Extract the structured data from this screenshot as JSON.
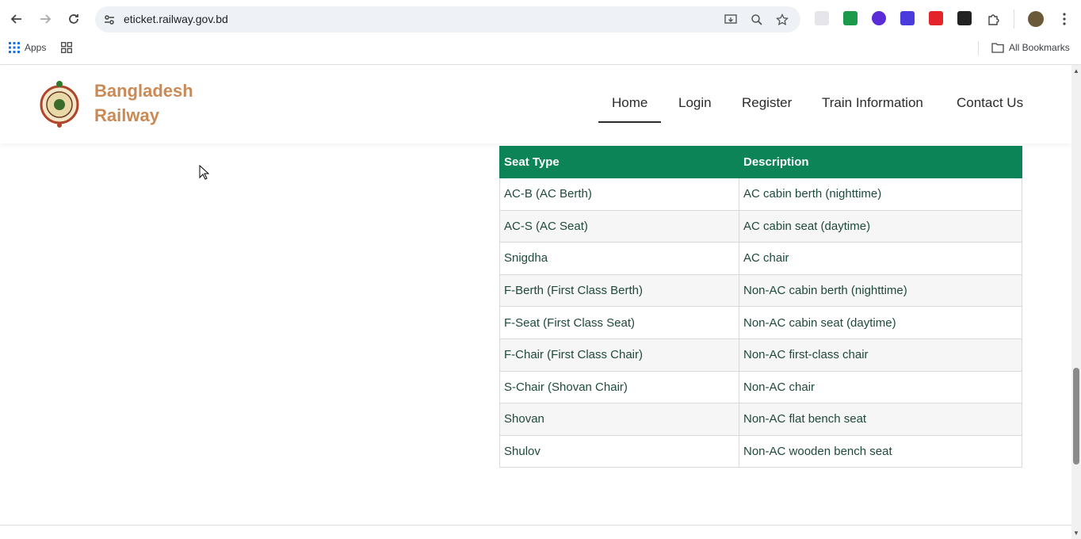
{
  "browser": {
    "url": "eticket.railway.gov.bd",
    "bookmarks": {
      "apps_label": "Apps",
      "all_bookmarks_label": "All Bookmarks"
    }
  },
  "site": {
    "brand_line1": "Bangladesh",
    "brand_line2": "Railway",
    "nav": {
      "home": "Home",
      "login": "Login",
      "register": "Register",
      "train_information": "Train Information",
      "contact_us": "Contact Us"
    },
    "active_nav": "Home",
    "brand_color": "#c98a55",
    "accent_color": "#0d8457"
  },
  "table": {
    "headers": [
      "Seat Type",
      "Description"
    ],
    "rows": [
      [
        "AC-B (AC Berth)",
        "AC cabin berth (nighttime)"
      ],
      [
        "AC-S (AC Seat)",
        "AC cabin seat (daytime)"
      ],
      [
        "Snigdha",
        "AC chair"
      ],
      [
        "F-Berth (First Class Berth)",
        "Non-AC cabin berth (nighttime)"
      ],
      [
        "F-Seat (First Class Seat)",
        "Non-AC cabin seat (daytime)"
      ],
      [
        "F-Chair (First Class Chair)",
        "Non-AC first-class chair"
      ],
      [
        "S-Chair (Shovan Chair)",
        "Non-AC chair"
      ],
      [
        "Shovan",
        "Non-AC flat bench seat"
      ],
      [
        "Shulov",
        "Non-AC wooden bench seat"
      ]
    ]
  }
}
